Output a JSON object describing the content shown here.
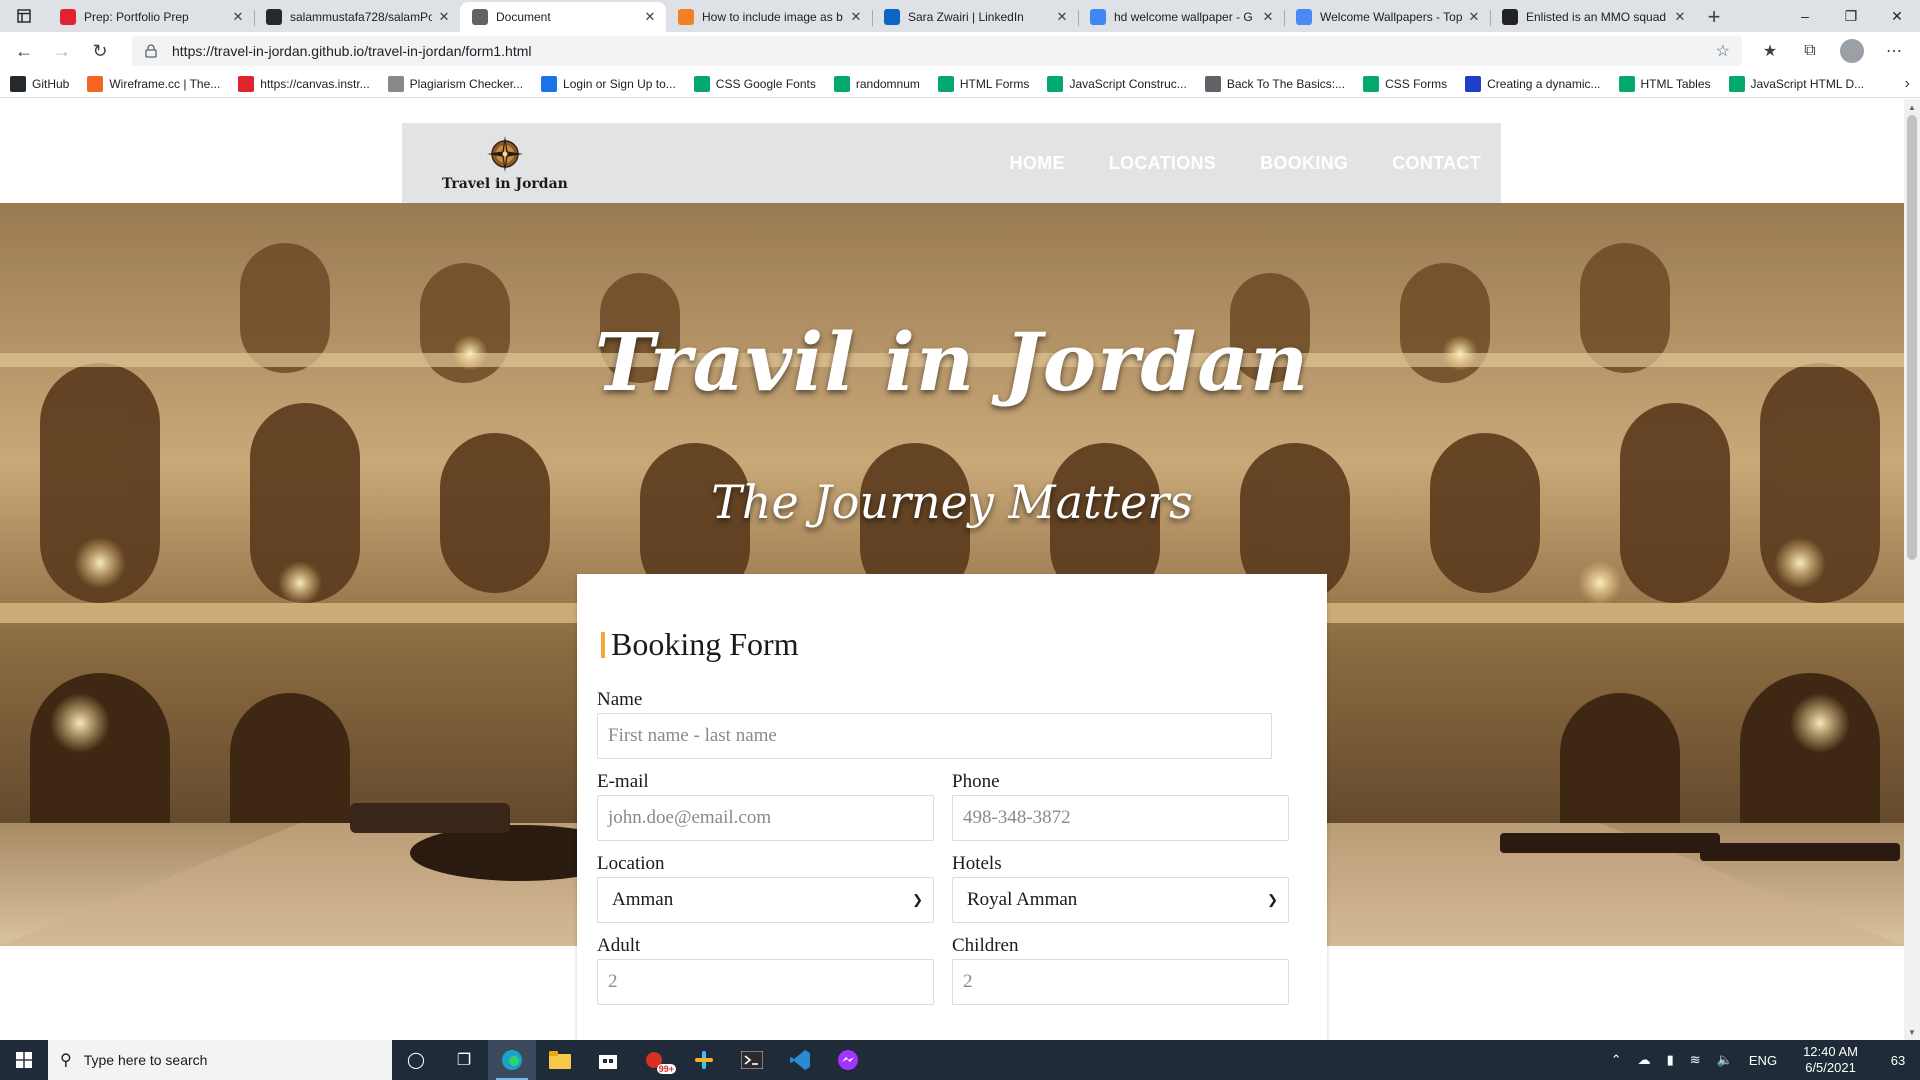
{
  "browser": {
    "tabs": [
      {
        "title": "Prep: Portfolio Prep",
        "favicon": "canvas-icon",
        "favicon_color": "#e0242d",
        "active": false
      },
      {
        "title": "salammustafa728/salamPo",
        "favicon": "github-icon",
        "favicon_color": "#24292e",
        "active": false
      },
      {
        "title": "Document",
        "favicon": "document-icon",
        "favicon_color": "#5f6368",
        "active": true
      },
      {
        "title": "How to include image as b",
        "favicon": "stackoverflow-icon",
        "favicon_color": "#f48024",
        "active": false
      },
      {
        "title": "Sara Zwairi | LinkedIn",
        "favicon": "linkedin-icon",
        "favicon_color": "#0a66c2",
        "active": false
      },
      {
        "title": "hd welcome wallpaper - G",
        "favicon": "google-icon",
        "favicon_color": "#4285f4",
        "active": false
      },
      {
        "title": "Welcome Wallpapers - Top",
        "favicon": "wallpaper-icon",
        "favicon_color": "#4a8af4",
        "active": false
      },
      {
        "title": "Enlisted is an MMO squad",
        "favicon": "game-icon",
        "favicon_color": "#222222",
        "active": false
      }
    ],
    "url": "https://travel-in-jordan.github.io/travel-in-jordan/form1.html",
    "bookmarks": [
      {
        "label": "GitHub",
        "icon": "github-icon",
        "color": "#24292e"
      },
      {
        "label": "Wireframe.cc | The...",
        "icon": "wireframe-icon",
        "color": "#f26522"
      },
      {
        "label": "https://canvas.instr...",
        "icon": "canvas-icon",
        "color": "#e0242d"
      },
      {
        "label": "Plagiarism Checker...",
        "icon": "sst-icon",
        "color": "#888888"
      },
      {
        "label": "Login or Sign Up to...",
        "icon": "login-icon",
        "color": "#1a73e8"
      },
      {
        "label": "CSS Google Fonts",
        "icon": "w3schools-icon",
        "color": "#04aa6d"
      },
      {
        "label": "randomnum",
        "icon": "w3schools-icon",
        "color": "#04aa6d"
      },
      {
        "label": "HTML Forms",
        "icon": "w3schools-icon",
        "color": "#04aa6d"
      },
      {
        "label": "JavaScript Construc...",
        "icon": "w3schools-icon",
        "color": "#04aa6d"
      },
      {
        "label": "Back To The Basics:...",
        "icon": "document-icon",
        "color": "#5f6368"
      },
      {
        "label": "CSS Forms",
        "icon": "w3schools-icon",
        "color": "#04aa6d"
      },
      {
        "label": "Creating a dynamic...",
        "icon": "js-icon",
        "color": "#1e40c8"
      },
      {
        "label": "HTML Tables",
        "icon": "w3schools-icon",
        "color": "#04aa6d"
      },
      {
        "label": "JavaScript HTML D...",
        "icon": "w3schools-icon",
        "color": "#04aa6d"
      }
    ]
  },
  "site": {
    "logo_text": "Travel in Jordan",
    "menu": [
      "HOME",
      "LOCATIONS",
      "BOOKING",
      "CONTACT"
    ],
    "hero_title": "Travil in Jordan",
    "hero_subtitle": "The Journey Matters"
  },
  "form": {
    "heading": "Booking Form",
    "accent_color": "#f2a83a",
    "name_label": "Name",
    "name_placeholder": "First name - last name",
    "email_label": "E-mail",
    "email_placeholder": "john.doe@email.com",
    "phone_label": "Phone",
    "phone_placeholder": "498-348-3872",
    "location_label": "Location",
    "location_value": "Amman",
    "hotels_label": "Hotels",
    "hotels_value": "Royal Amman",
    "adult_label": "Adult",
    "adult_placeholder": "2",
    "children_label": "Children",
    "children_placeholder": "2"
  },
  "taskbar": {
    "search_placeholder": "Type here to search",
    "badge": "99+",
    "language": "ENG",
    "time": "12:40 AM",
    "date": "6/5/2021",
    "notification_count": "63"
  }
}
